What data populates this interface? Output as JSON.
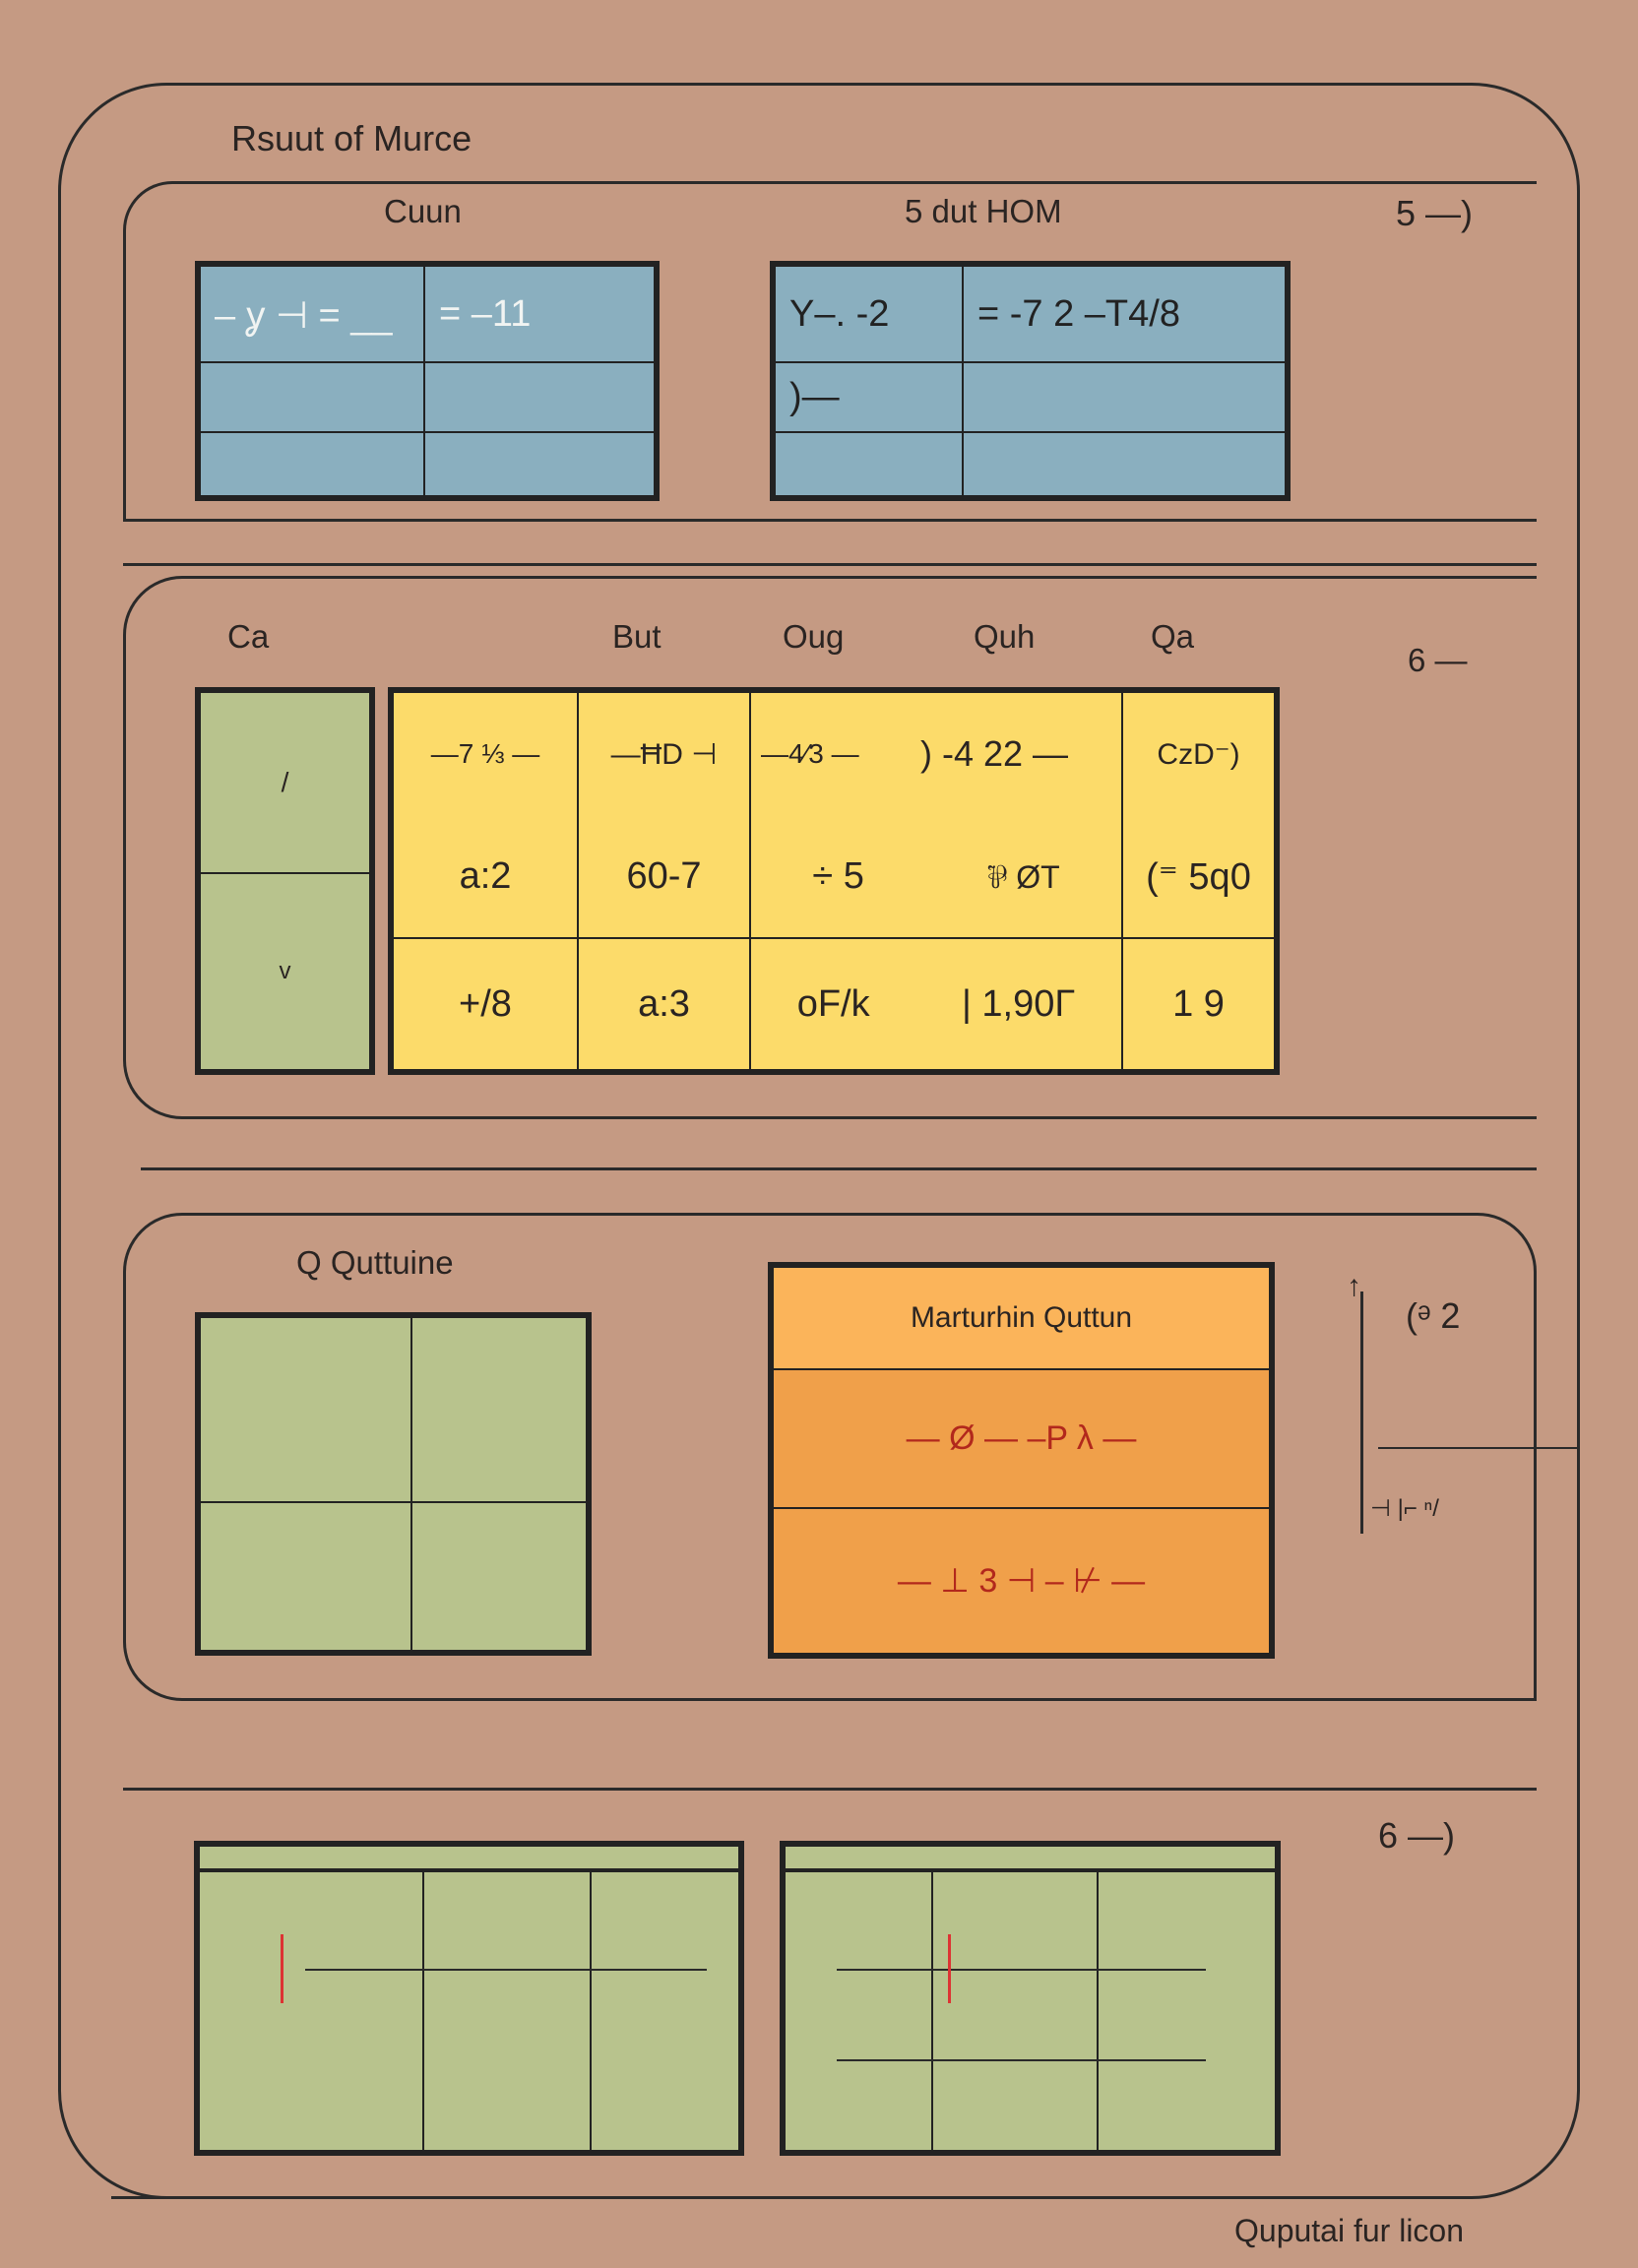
{
  "app": {
    "title": "Rsuut of Murce"
  },
  "section1": {
    "header_left": "Cuun",
    "header_center": "5 dut HOM",
    "header_right": "5 —)",
    "table_left": {
      "rows": [
        [
          "– ỿ ⊣ = __",
          "= –11"
        ],
        [
          "",
          ""
        ],
        [
          "",
          ""
        ]
      ]
    },
    "table_right": {
      "rows": [
        [
          "Y–. -2",
          "= -7 2   –T4/8"
        ],
        [
          ")—",
          ""
        ],
        [
          "",
          ""
        ]
      ]
    }
  },
  "section2": {
    "headers": [
      "Ca",
      "But",
      "Oug",
      "Quh",
      "Qa"
    ],
    "side_label": "6 —",
    "row_labels": [
      "/",
      "v"
    ],
    "table": {
      "rows": [
        [
          "—7 ⅓ —",
          "—ĦD ⊣",
          "—4⁄3 —",
          ") -4 22 —",
          "CzD⁻)"
        ],
        [
          "a:2",
          "60-7",
          "÷ 5",
          "⅌ ØT",
          "(⁼ 5q0"
        ],
        [
          "+/8",
          "a:3",
          "oF/k",
          "| 1,90Γ",
          "1 9"
        ]
      ]
    }
  },
  "section3": {
    "title": "Q Quttuine",
    "orange_panel": {
      "header": "Marturhin Quttun",
      "rows": [
        "— Ø — –P λ —",
        "— ⊥ 3 ⊣ – ⊬ —"
      ]
    },
    "axis": {
      "top_label": "(ᵊ 2",
      "bottom_label": "⊣ |⌐ ⁿ/"
    }
  },
  "section4": {
    "side_label": "6 —)"
  },
  "footer": {
    "label": "Quputai fur licon"
  },
  "colors": {
    "background": "#c59a83",
    "blue": "#8aafbf",
    "yellow": "#fcdb6a",
    "green": "#b8c38d",
    "orange": "#f0a04a",
    "orange_header": "#fbb45a",
    "accent_red": "#b2281c"
  }
}
